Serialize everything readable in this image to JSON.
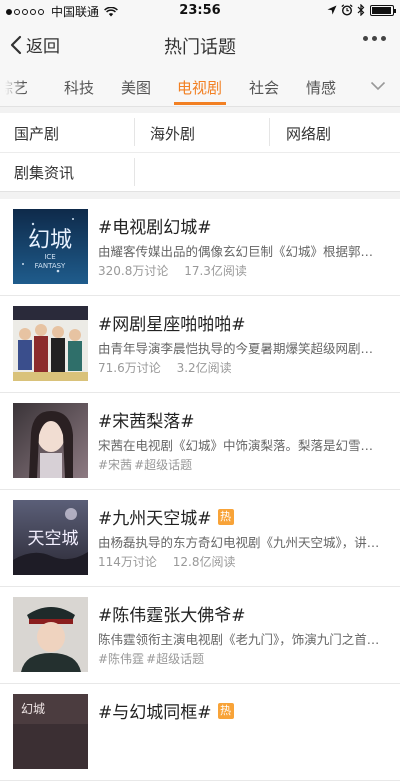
{
  "status_bar": {
    "carrier": "中国联通",
    "time": "23:56"
  },
  "nav": {
    "back_label": "返回",
    "title": "热门话题",
    "more_icon": "more-dots-icon"
  },
  "tabs": [
    {
      "label": "综艺",
      "active": false
    },
    {
      "label": "科技",
      "active": false
    },
    {
      "label": "美图",
      "active": false
    },
    {
      "label": "电视剧",
      "active": true
    },
    {
      "label": "社会",
      "active": false
    },
    {
      "label": "情感",
      "active": false
    }
  ],
  "categories": [
    "国产剧",
    "海外剧",
    "网络剧",
    "剧集资讯"
  ],
  "topics": [
    {
      "title": "#电视剧幻城#",
      "hot": false,
      "desc": "由耀客传媒出品的偶像玄幻巨制《幻城》根据郭敬明同名小说改编",
      "discuss": "320.8万讨论",
      "reads": "17.3亿阅读",
      "thumb_text": [
        "幻城",
        "ICE",
        "FANTASY"
      ]
    },
    {
      "title": "#网剧星座啪啪啪#",
      "hot": false,
      "desc": "由青年导演李晨恺执导的今夏暑期爆笑超级网剧来袭",
      "discuss": "71.6万讨论",
      "reads": "3.2亿阅读",
      "thumb_text": []
    },
    {
      "title": "#宋茜梨落#",
      "hot": false,
      "desc": "宋茜在电视剧《幻城》中饰演梨落。梨落是幻雪神山的冰族灵女",
      "tags": [
        "#宋茜",
        "#超级话题"
      ],
      "thumb_text": []
    },
    {
      "title": "#九州天空城#",
      "hot": true,
      "hot_label": "热",
      "desc": "由杨磊执导的东方奇幻电视剧《九州天空城》，讲述了一段传奇",
      "discuss": "114万讨论",
      "reads": "12.8亿阅读",
      "thumb_text": [
        "天空城"
      ]
    },
    {
      "title": "#陈伟霆张大佛爷#",
      "hot": false,
      "desc": "陈伟霆领衔主演电视剧《老九门》，饰演九门之首张启山",
      "tags": [
        "#陈伟霆",
        "#超级话题"
      ],
      "thumb_text": []
    },
    {
      "title": "#与幻城同框#",
      "hot": true,
      "hot_label": "热",
      "desc": "",
      "thumb_text": [
        "幻城"
      ]
    }
  ],
  "colors": {
    "accent": "#f28023",
    "hot_badge": "#f8a338"
  }
}
